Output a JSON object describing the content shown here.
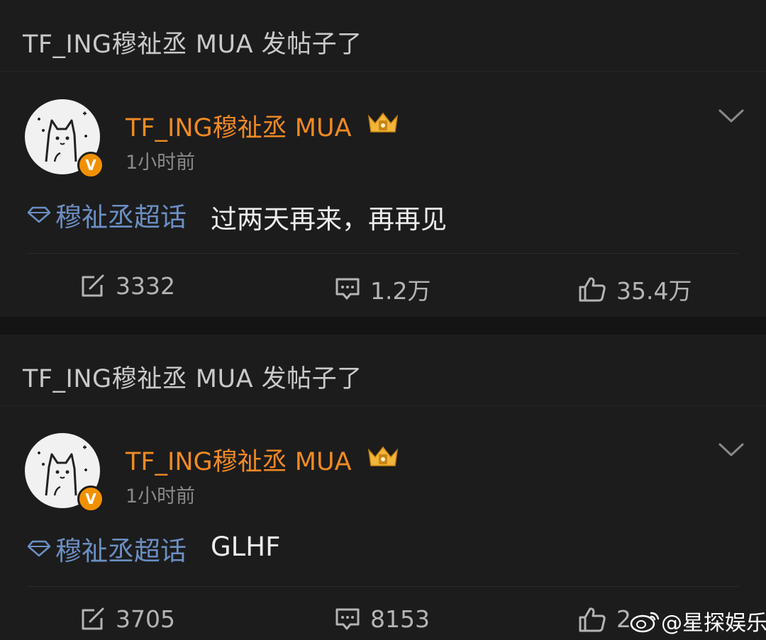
{
  "posts": [
    {
      "header": "TF_ING穆祉丞 MUA 发帖子了",
      "username": "TF_ING穆祉丞 MUA",
      "verified_badge": "V",
      "time": "1小时前",
      "topic": "穆祉丞超话",
      "text": "过两天再来，再再见",
      "repost_count": "3332",
      "comment_count": "1.2万",
      "like_count": "35.4万"
    },
    {
      "header": "TF_ING穆祉丞 MUA 发帖子了",
      "username": "TF_ING穆祉丞 MUA",
      "verified_badge": "V",
      "time": "1小时前",
      "topic": "穆祉丞超话",
      "text": "GLHF",
      "repost_count": "3705",
      "comment_count": "8153",
      "like_count": "2"
    }
  ],
  "watermark": "@星探娱乐",
  "colors": {
    "username": "#f08a24",
    "topic": "#6b8fc4",
    "badge": "#f29100",
    "background": "#141414",
    "card": "#1c1c1c"
  },
  "icons": [
    "chevron-down-icon",
    "diamond-icon",
    "repost-icon",
    "comment-icon",
    "like-icon",
    "crown-icon",
    "weibo-logo-icon"
  ]
}
